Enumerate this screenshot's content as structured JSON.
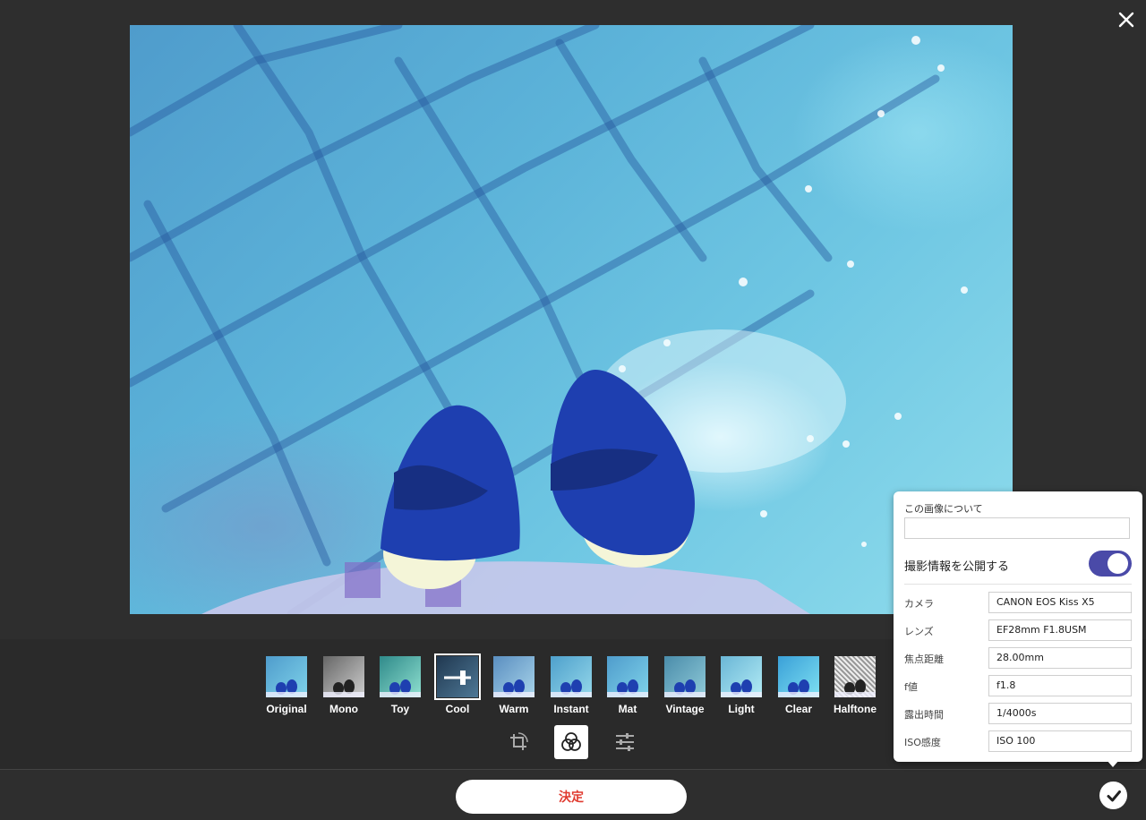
{
  "close_icon": "close-icon",
  "filters": [
    {
      "label": "Original",
      "selected": false
    },
    {
      "label": "Mono",
      "selected": false
    },
    {
      "label": "Toy",
      "selected": false
    },
    {
      "label": "Cool",
      "selected": true
    },
    {
      "label": "Warm",
      "selected": false
    },
    {
      "label": "Instant",
      "selected": false
    },
    {
      "label": "Mat",
      "selected": false
    },
    {
      "label": "Vintage",
      "selected": false
    },
    {
      "label": "Light",
      "selected": false
    },
    {
      "label": "Clear",
      "selected": false
    },
    {
      "label": "Halftone",
      "selected": false
    }
  ],
  "tools": [
    {
      "name": "crop-rotate-icon",
      "active": false
    },
    {
      "name": "filter-circles-icon",
      "active": true
    },
    {
      "name": "adjust-sliders-icon",
      "active": false
    }
  ],
  "confirm_label": "決定",
  "check_icon": "check-icon",
  "info_panel": {
    "about_label": "この画像について",
    "about_value": "",
    "publish_label": "撮影情報を公開する",
    "publish_enabled": true,
    "meta": [
      {
        "label": "カメラ",
        "value": "CANON EOS Kiss X5"
      },
      {
        "label": "レンズ",
        "value": "EF28mm F1.8USM"
      },
      {
        "label": "焦点距離",
        "value": "28.00mm"
      },
      {
        "label": "f値",
        "value": "f1.8"
      },
      {
        "label": "露出時間",
        "value": "1/4000s"
      },
      {
        "label": "ISO感度",
        "value": "ISO 100"
      }
    ]
  },
  "colors": {
    "accent_toggle": "#4a4aa8",
    "confirm_text": "#e03a2f",
    "background": "#2e2e2e"
  }
}
